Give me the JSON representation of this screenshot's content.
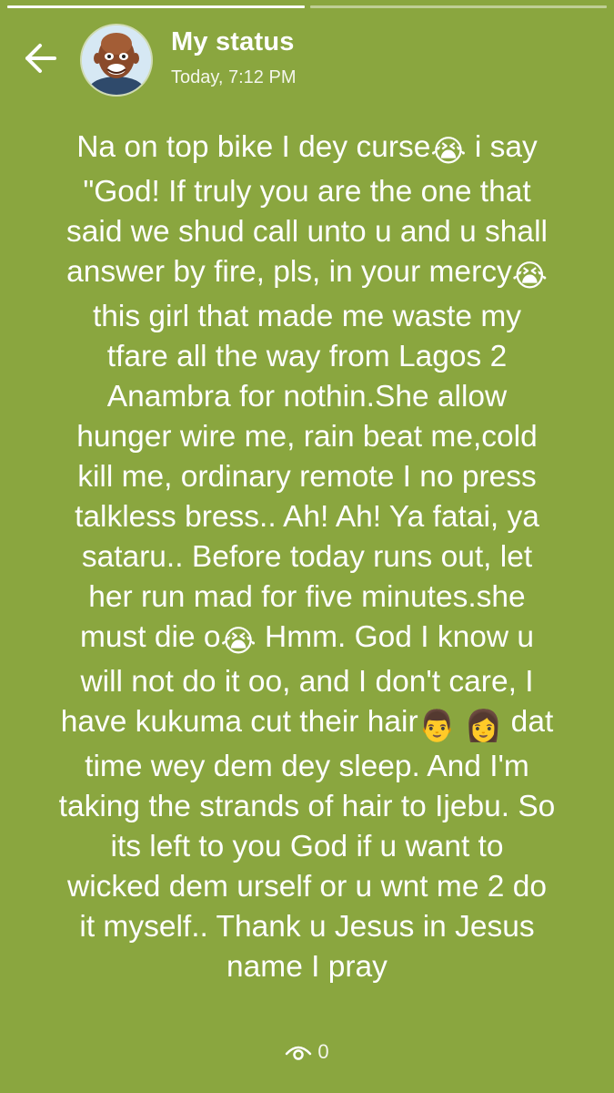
{
  "progress": {
    "segments": 2,
    "active": 1
  },
  "header": {
    "back_icon": "arrow-left-icon",
    "title": "My status",
    "timestamp": "Today, 7:12 PM"
  },
  "status": {
    "lines": [
      [
        "Na on top bike I dey curse",
        "😭",
        " i say"
      ],
      [
        "\"God! If truly you are the one that"
      ],
      [
        "said we shud call unto u and u shall"
      ],
      [
        "answer by fire, pls, in your mercy",
        "😭"
      ],
      [
        "this girl that made me waste my"
      ],
      [
        "tfare all the way from Lagos 2"
      ],
      [
        "Anambra for nothin.She allow"
      ],
      [
        "hunger wire me, rain beat me,cold"
      ],
      [
        "kill me, ordinary remote I no press"
      ],
      [
        "talkless bress.. Ah! Ah! Ya fatai, ya"
      ],
      [
        "sataru.. Before today runs out, let"
      ],
      [
        "her run mad for five minutes.she"
      ],
      [
        "must die o",
        "😭",
        " Hmm. God I know u"
      ],
      [
        "will not do it oo, and I don't care, I"
      ],
      [
        "have kukuma cut their hair",
        "👨",
        " ",
        "👩",
        "  dat"
      ],
      [
        "time wey dem dey sleep. And I'm"
      ],
      [
        "taking the strands of hair to Ijebu. So"
      ],
      [
        "its left to you God if u want to"
      ],
      [
        "wicked dem urself or u wnt me 2 do"
      ],
      [
        "it myself.. Thank u Jesus in Jesus"
      ],
      [
        "name I pray"
      ]
    ]
  },
  "footer": {
    "views_icon": "eye-icon",
    "views_count": "0"
  },
  "colors": {
    "background": "#8aa63f",
    "text": "#ffffff"
  }
}
